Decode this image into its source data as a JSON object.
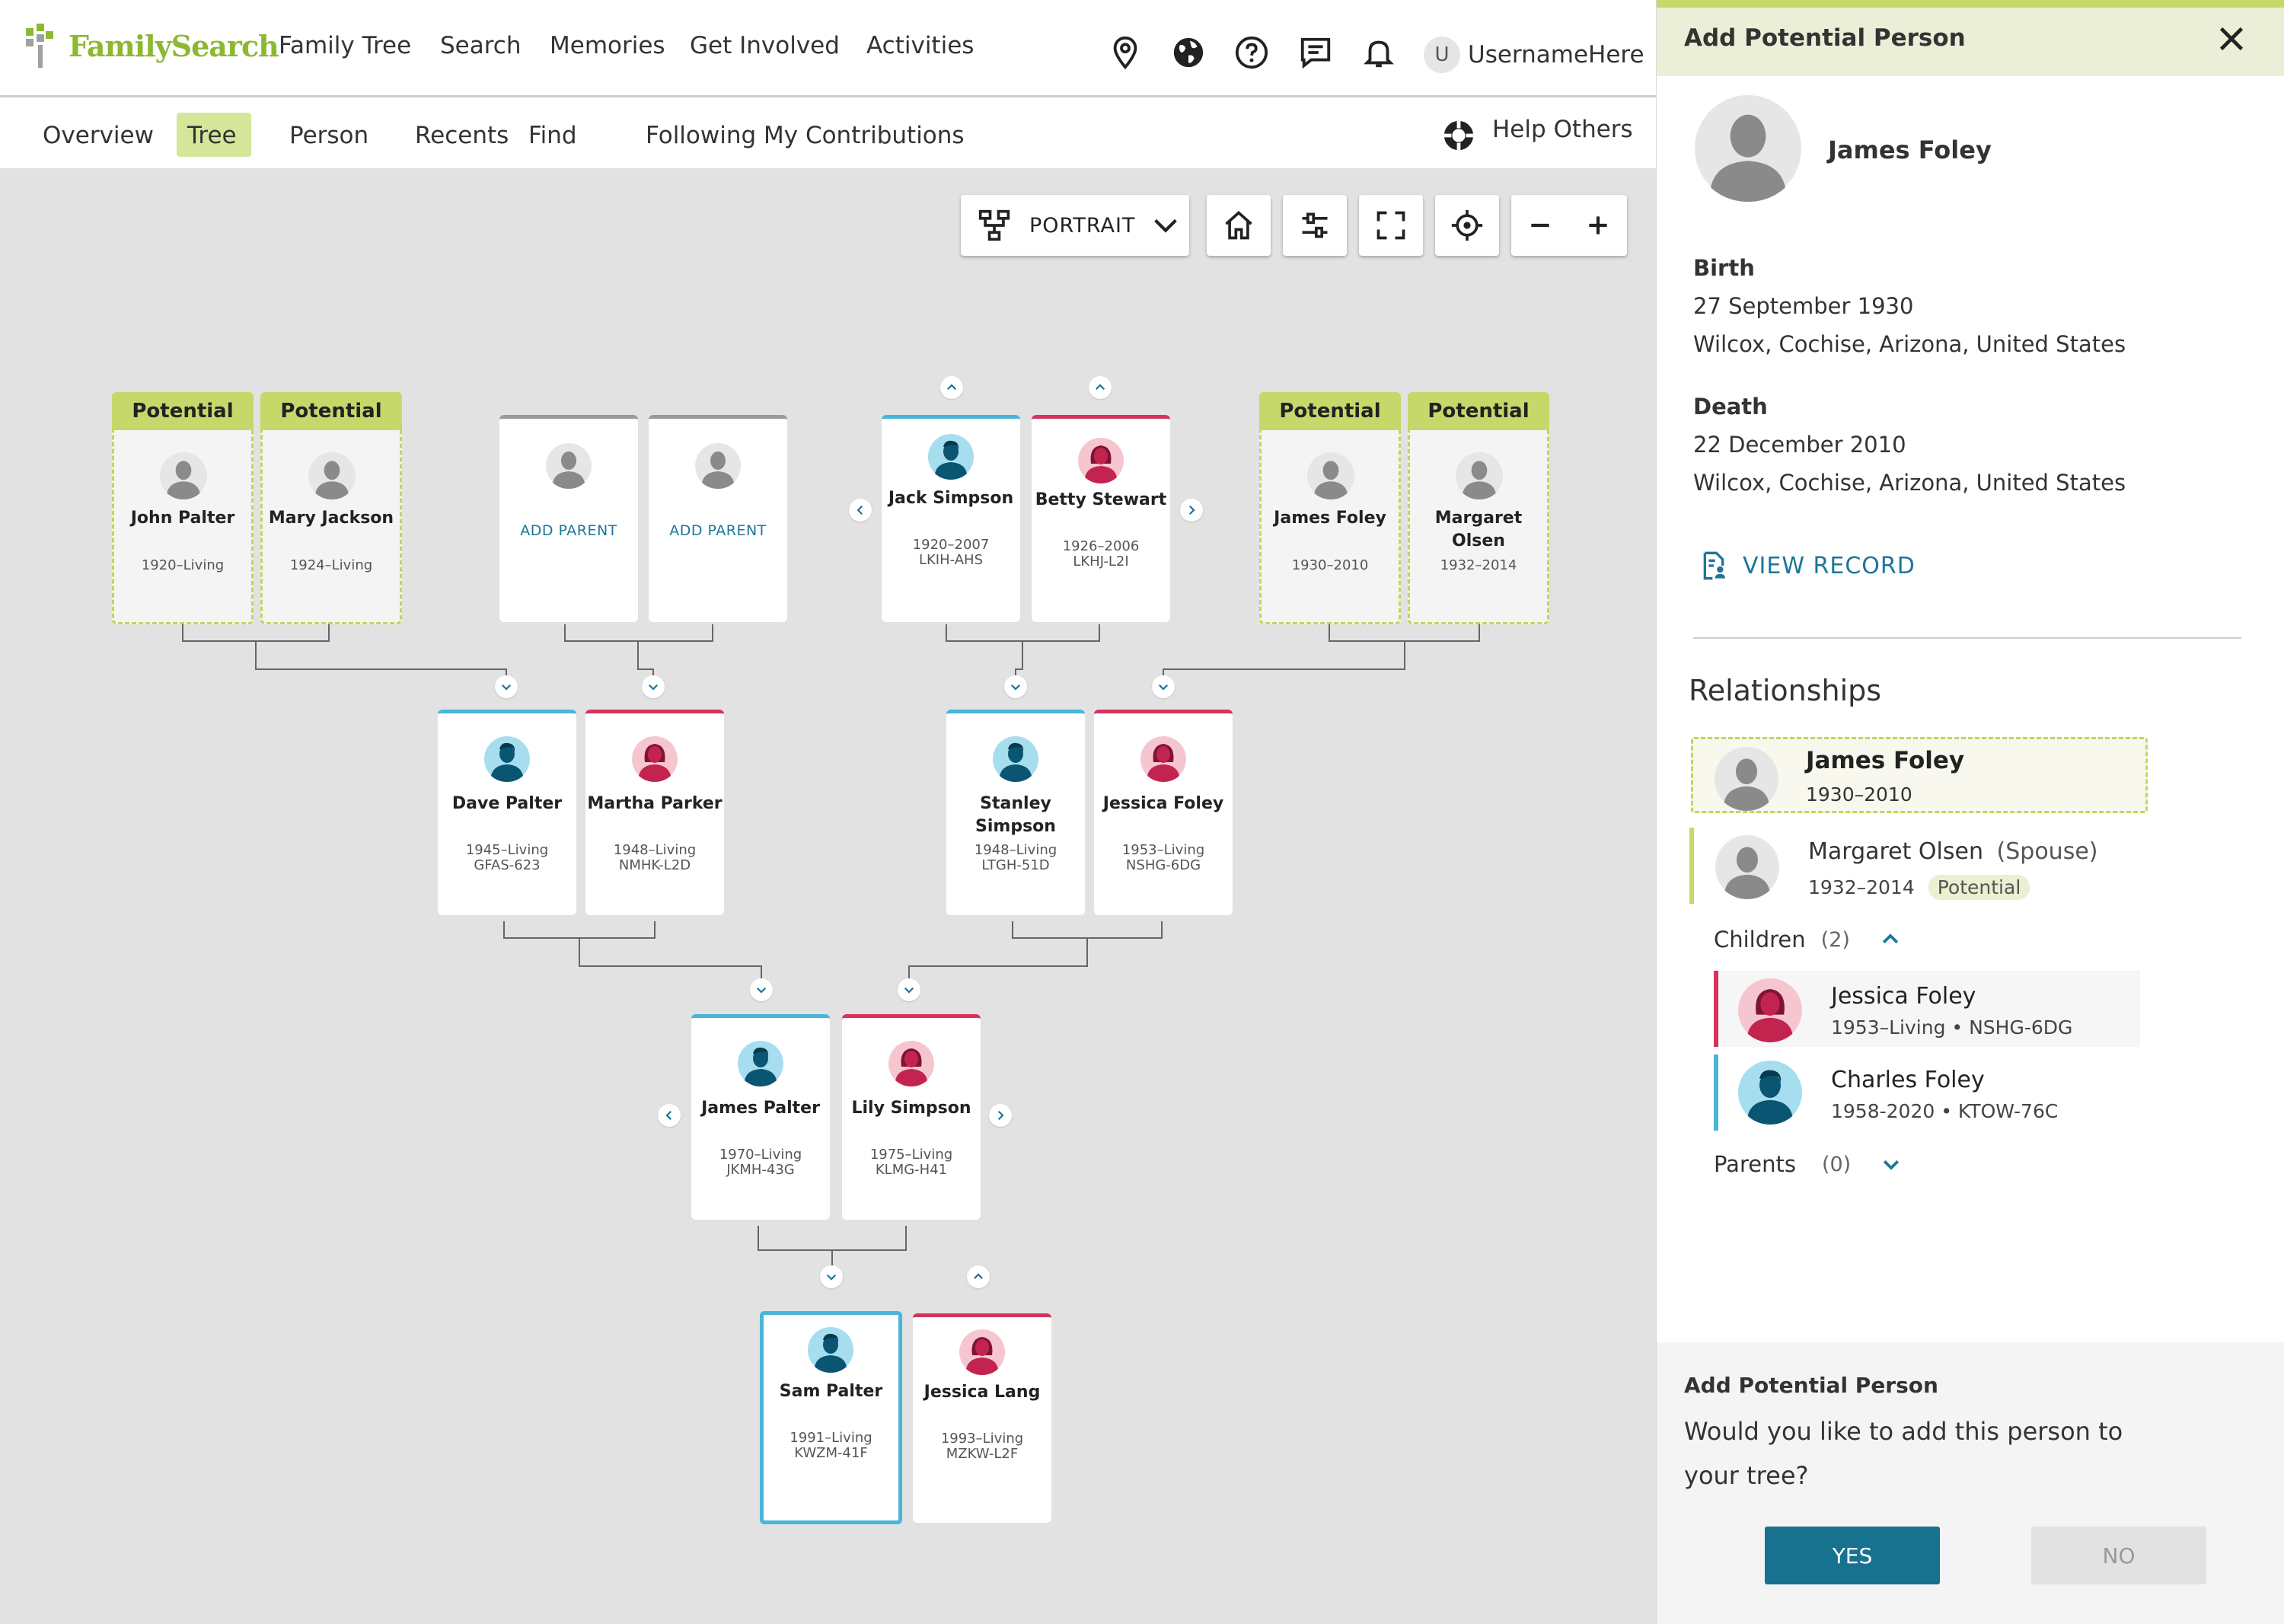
{
  "nav": {
    "brand": "FamilySearch",
    "items": [
      "Family Tree",
      "Search",
      "Memories",
      "Get Involved",
      "Activities"
    ],
    "icons": [
      "location-pin-icon",
      "globe-icon",
      "help-circle-icon",
      "chat-icon",
      "bell-icon"
    ],
    "avatar_initial": "U",
    "username": "UsernameHere"
  },
  "subnav": {
    "items": [
      "Overview",
      "Tree",
      "Person",
      "Recents",
      "Find",
      "Following",
      "My Contributions"
    ],
    "active": "Tree",
    "help": "Help Others"
  },
  "toolbar": {
    "view_label": "PORTRAIT"
  },
  "tree": {
    "potential_label": "Potential",
    "add_parent_label": "ADD PARENT",
    "people": {
      "john_palter": {
        "name": "John Palter",
        "dates": "1920–Living"
      },
      "mary_jackson": {
        "name": "Mary Jackson",
        "dates": "1924–Living"
      },
      "jack_simpson": {
        "name": "Jack Simpson",
        "dates": "1920–2007",
        "id": "LKIH-AHS"
      },
      "betty_stewart": {
        "name": "Betty Stewart",
        "dates": "1926–2006",
        "id": "LKHJ-L2I"
      },
      "james_foley": {
        "name": "James Foley",
        "dates": "1930–2010"
      },
      "margaret_olsen": {
        "name": "Margaret Olsen",
        "dates": "1932–2014"
      },
      "dave_palter": {
        "name": "Dave Palter",
        "dates": "1945–Living",
        "id": "GFAS-623"
      },
      "martha_parker": {
        "name": "Martha Parker",
        "dates": "1948–Living",
        "id": "NMHK-L2D"
      },
      "stanley_simpson": {
        "name": "Stanley Simpson",
        "dates": "1948–Living",
        "id": "LTGH-51D"
      },
      "jessica_foley": {
        "name": "Jessica Foley",
        "dates": "1953–Living",
        "id": "NSHG-6DG"
      },
      "james_palter": {
        "name": "James Palter",
        "dates": "1970–Living",
        "id": "JKMH-43G"
      },
      "lily_simpson": {
        "name": "Lily Simpson",
        "dates": "1975–Living",
        "id": "KLMG-H41"
      },
      "sam_palter": {
        "name": "Sam Palter",
        "dates": "1991–Living",
        "id": "KWZM-41F"
      },
      "jessica_lang": {
        "name": "Jessica Lang",
        "dates": "1993–Living",
        "id": "MZKW-L2F"
      }
    }
  },
  "panel": {
    "title": "Add Potential Person",
    "person_name": "James Foley",
    "birth_label": "Birth",
    "birth_date": "27 September 1930",
    "birth_place": "Wilcox, Cochise, Arizona, United States",
    "death_label": "Death",
    "death_date": "22 December 2010",
    "death_place": "Wilcox, Cochise, Arizona, United States",
    "view_record": "VIEW RECORD",
    "relationships_heading": "Relationships",
    "focus": {
      "name": "James Foley",
      "dates": "1930–2010"
    },
    "spouse": {
      "name": "Margaret Olsen",
      "role": "(Spouse)",
      "dates": "1932–2014",
      "badge": "Potential"
    },
    "children_label": "Children",
    "children_count": "(2)",
    "children": [
      {
        "name": "Jessica Foley",
        "info": "1953–Living • NSHG-6DG"
      },
      {
        "name": "Charles Foley",
        "info": "1958-2020 • KTOW-76C"
      }
    ],
    "parents_label": "Parents",
    "parents_count": "(0)",
    "prompt_title": "Add Potential Person",
    "prompt_text": "Would you like to add this person to your tree?",
    "yes": "YES",
    "no": "NO"
  },
  "colors": {
    "male": "#4ab5d9",
    "female": "#d6335e",
    "potential": "#c6d86a",
    "primary_button": "#17728f"
  }
}
